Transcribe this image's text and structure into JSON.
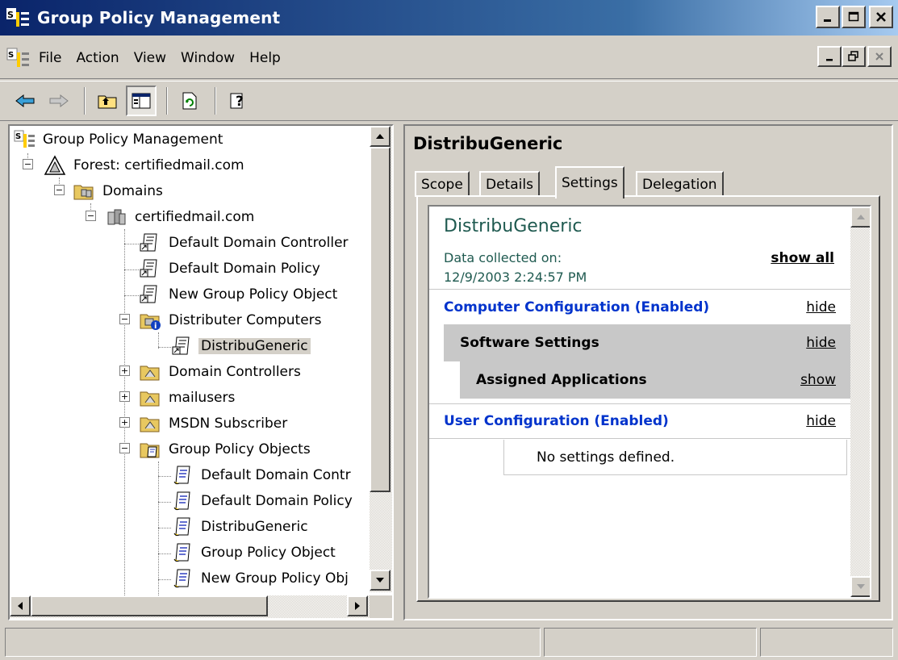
{
  "window": {
    "title": "Group Policy Management"
  },
  "menu": [
    "File",
    "Action",
    "View",
    "Window",
    "Help"
  ],
  "toolbar": {
    "buttons": [
      "back-icon",
      "forward-icon",
      "up-folder-icon",
      "show-hide-tree-icon",
      "refresh-icon",
      "help-icon"
    ]
  },
  "tree": {
    "root": "Group Policy Management",
    "forest": "Forest: certifiedmail.com",
    "domains": "Domains",
    "domain": "certifiedmail.com",
    "links": [
      "Default Domain Controller",
      "Default Domain Policy",
      "New Group Policy Object"
    ],
    "ou_distributer": "Distributer Computers",
    "selected": "DistribuGeneric",
    "ous": [
      "Domain Controllers",
      "mailusers",
      "MSDN Subscriber"
    ],
    "gpo_container": "Group Policy Objects",
    "gpos": [
      "Default Domain Contr",
      "Default Domain Policy",
      "DistribuGeneric",
      "Group Policy Object",
      "New Group Policy Obj"
    ]
  },
  "details": {
    "title": "DistribuGeneric",
    "tabs": [
      "Scope",
      "Details",
      "Settings",
      "Delegation"
    ],
    "active_tab": "Settings",
    "report": {
      "title": "DistribuGeneric",
      "collected_label": "Data collected on:",
      "collected_value": "12/9/2003 2:24:57 PM",
      "show_all": "show all",
      "computer_config": "Computer Configuration (Enabled)",
      "computer_config_link": "hide",
      "software_settings": "Software Settings",
      "software_settings_link": "hide",
      "assigned_apps": "Assigned Applications",
      "assigned_apps_link": "show",
      "user_config": "User Configuration (Enabled)",
      "user_config_link": "hide",
      "no_settings": "No settings defined."
    }
  },
  "colors": {
    "face": "#d4d0c8",
    "title_gradient_start": "#0a246a",
    "link_blue": "#0033cc",
    "report_teal": "#1f5a50",
    "section_gray": "#c8c8c8"
  }
}
